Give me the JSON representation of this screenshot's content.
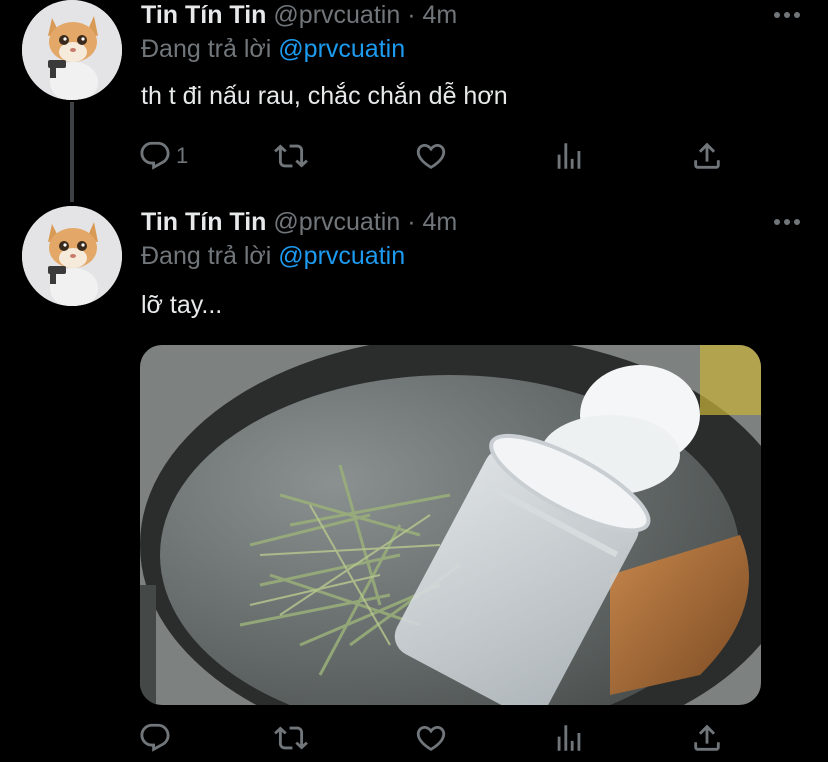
{
  "tweets": [
    {
      "name": "Tin Tín Tin",
      "handle": "@prvcuatin",
      "dot": "·",
      "time": "4m",
      "reply_prefix": "Đang trả lời",
      "reply_handle": "@prvcuatin",
      "text": "th t đi nấu rau, chắc chắn dễ hơn",
      "reply_count": "1"
    },
    {
      "name": "Tin Tín Tin",
      "handle": "@prvcuatin",
      "dot": "·",
      "time": "4m",
      "reply_prefix": "Đang trả lời",
      "reply_handle": "@prvcuatin",
      "text": "lỡ tay...",
      "reply_count": ""
    }
  ],
  "icons": {
    "reply": "reply-icon",
    "retweet": "retweet-icon",
    "like": "heart-icon",
    "stats": "analytics-icon",
    "share": "share-icon",
    "more": "more-icon"
  },
  "colors": {
    "background": "#000000",
    "text": "#e7e9ea",
    "muted": "#71767b",
    "link": "#1d9bf0"
  }
}
